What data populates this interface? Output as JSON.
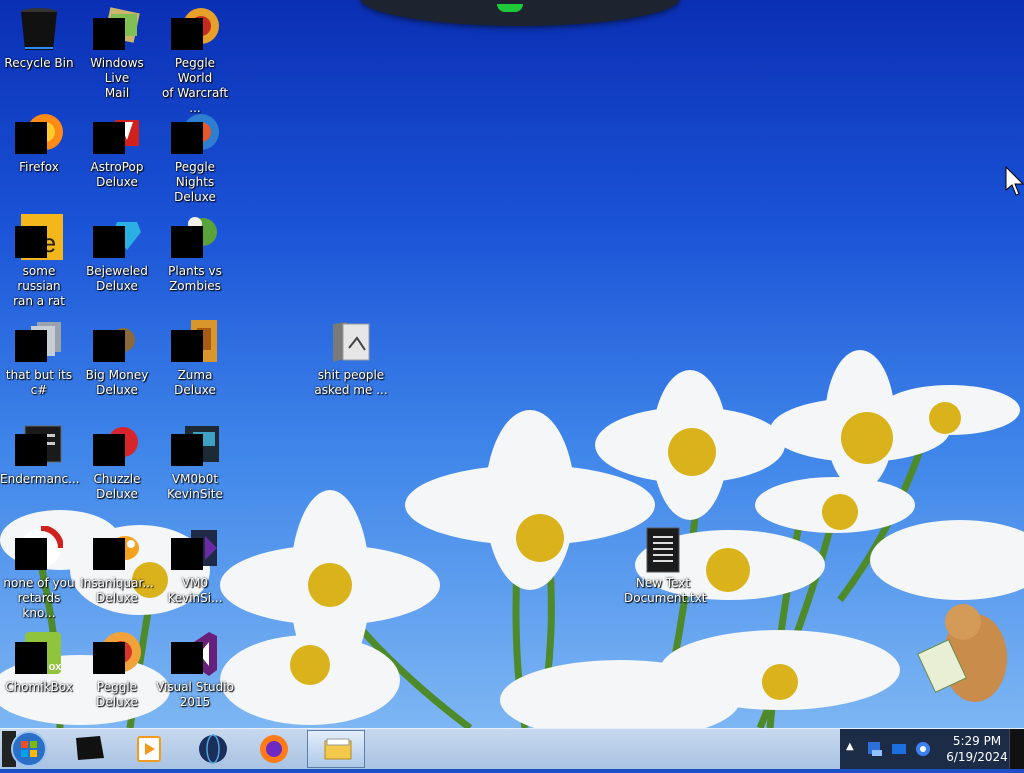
{
  "desktop": {
    "icons": [
      {
        "name": "recycle-bin-icon",
        "label": "Recycle Bin",
        "masked": false
      },
      {
        "name": "windows-live-mail-icon",
        "label": "Windows Live\nMail",
        "masked": true
      },
      {
        "name": "peggle-world-of-warcraft-icon",
        "label": "Peggle World\nof Warcraft ...",
        "masked": true
      },
      {
        "name": "firefox-icon",
        "label": "Firefox",
        "masked": true
      },
      {
        "name": "astropop-deluxe-icon",
        "label": "AstroPop\nDeluxe",
        "masked": true
      },
      {
        "name": "peggle-nights-deluxe-icon",
        "label": "Peggle Nights\nDeluxe",
        "masked": true
      },
      {
        "name": "russian-rat-icon",
        "label": "some russian\nran a rat",
        "masked": true
      },
      {
        "name": "bejeweled-deluxe-icon",
        "label": "Bejeweled\nDeluxe",
        "masked": true
      },
      {
        "name": "plants-vs-zombies-icon",
        "label": "Plants vs\nZombies",
        "masked": true
      },
      {
        "name": "that-but-its-csharp-icon",
        "label": "that but its c#",
        "masked": true
      },
      {
        "name": "big-money-deluxe-icon",
        "label": "Big Money\nDeluxe",
        "masked": true
      },
      {
        "name": "zuma-deluxe-icon",
        "label": "Zuma Deluxe",
        "masked": true
      },
      {
        "name": "endermanch-icon",
        "label": "Endermanc...",
        "masked": true
      },
      {
        "name": "chuzzle-deluxe-icon",
        "label": "Chuzzle\nDeluxe",
        "masked": true
      },
      {
        "name": "vm0b0t-kevinsite-icon",
        "label": "VM0b0t\nKevinSite",
        "masked": true
      },
      {
        "name": "none-of-you-icon",
        "label": "none of you\nretards kno...",
        "masked": true
      },
      {
        "name": "insaniquarium-deluxe-icon",
        "label": "Insaniquar...\nDeluxe",
        "masked": true
      },
      {
        "name": "vm0-kevinsi-icon",
        "label": "VM0\nKevinSi...",
        "masked": true
      },
      {
        "name": "chomikbox-icon",
        "label": "ChomikBox",
        "masked": true
      },
      {
        "name": "peggle-deluxe-icon",
        "label": "Peggle Deluxe",
        "masked": true
      },
      {
        "name": "visual-studio-2015-icon",
        "label": "Visual Studio\n2015",
        "masked": true
      },
      {
        "name": "shit-people-folder-icon",
        "label": "shit people\nasked me ...",
        "masked": false
      },
      {
        "name": "new-text-document-icon",
        "label": "New Text\nDocument.txt",
        "masked": false
      }
    ]
  },
  "taskbar": {
    "pinned": [
      {
        "name": "start-button",
        "icon": "windows-logo-icon"
      },
      {
        "name": "taskbar-terminal-button",
        "icon": "terminal-icon"
      },
      {
        "name": "taskbar-media-player-button",
        "icon": "media-player-icon"
      },
      {
        "name": "taskbar-globe-button",
        "icon": "globe-icon"
      },
      {
        "name": "taskbar-firefox-button",
        "icon": "firefox-icon"
      },
      {
        "name": "taskbar-explorer-button",
        "icon": "file-explorer-icon"
      }
    ],
    "tray": {
      "time": "5:29 PM",
      "date": "6/19/2024",
      "icons": [
        "show-hidden-icons-chevron",
        "network-icon",
        "display-icon",
        "volume-icon"
      ]
    }
  },
  "colors": {
    "sky_top": "#0a2fb4",
    "sky_bottom": "#7db6f3",
    "taskbar": "#b3cbe8",
    "tray": "#1c2c47"
  }
}
